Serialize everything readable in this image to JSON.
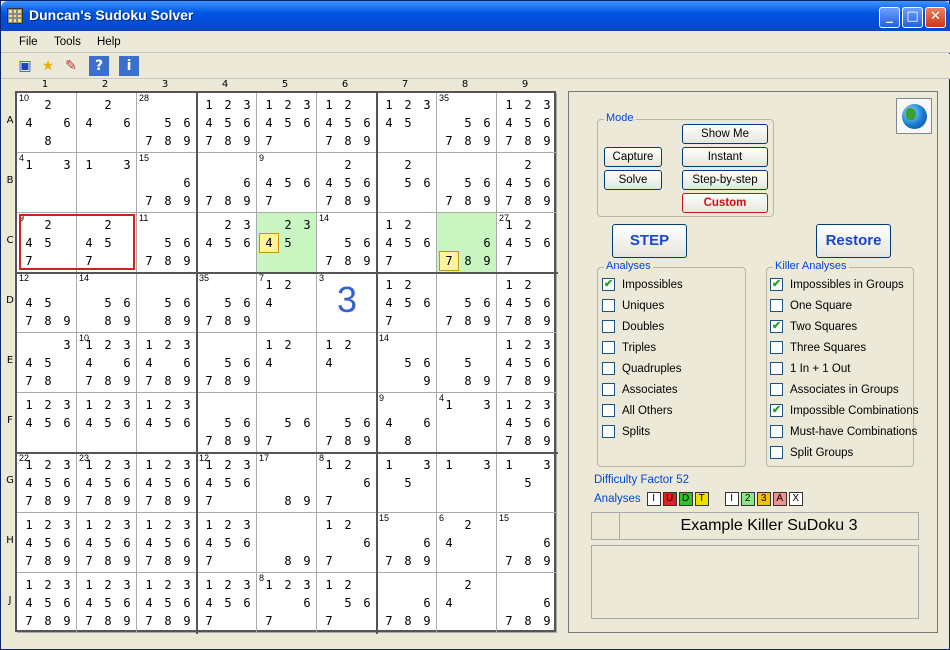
{
  "window": {
    "title": "Duncan's Sudoku Solver"
  },
  "menu": [
    "File",
    "Tools",
    "Help"
  ],
  "toolbar": {
    "icons": [
      "save-icon",
      "favorite-icon",
      "new-icon",
      "help-icon",
      "info-icon"
    ],
    "help": "?",
    "info": "i"
  },
  "columns": [
    "1",
    "2",
    "3",
    "4",
    "5",
    "6",
    "7",
    "8",
    "9"
  ],
  "rows": [
    "A",
    "B",
    "C",
    "D",
    "E",
    "F",
    "G",
    "H",
    "J"
  ],
  "cells": [
    [
      {
        "cage": "10",
        "c": [
          2,
          4,
          6,
          8
        ]
      },
      {
        "c": [
          2,
          4,
          6
        ]
      },
      {
        "cage": "28",
        "c": [
          5,
          6,
          7,
          8,
          9
        ]
      },
      {
        "c": [
          1,
          2,
          3,
          4,
          5,
          6,
          7,
          8,
          9
        ]
      },
      {
        "c": [
          1,
          2,
          3,
          4,
          5,
          6,
          7
        ]
      },
      {
        "c": [
          1,
          2,
          4,
          5,
          6,
          7,
          8,
          9
        ]
      },
      {
        "c": [
          1,
          2,
          3,
          4,
          5
        ]
      },
      {
        "cage": "35",
        "c": [
          5,
          6,
          7,
          8,
          9
        ]
      },
      {
        "c": [
          1,
          2,
          3,
          4,
          5,
          6,
          7,
          8,
          9
        ]
      }
    ],
    [
      {
        "cage": "4",
        "c": [
          1,
          3
        ]
      },
      {
        "c": [
          1,
          3
        ]
      },
      {
        "cage": "15",
        "c": [
          6,
          7,
          8,
          9
        ]
      },
      {
        "c": [
          6,
          7,
          8,
          9
        ]
      },
      {
        "cage": "9",
        "c": [
          4,
          5,
          6,
          7
        ]
      },
      {
        "c": [
          2,
          4,
          5,
          6,
          7,
          8,
          9
        ]
      },
      {
        "c": [
          2,
          5,
          6
        ]
      },
      {
        "c": [
          5,
          6,
          7,
          8,
          9
        ]
      },
      {
        "c": [
          2,
          4,
          5,
          6,
          7,
          8,
          9
        ]
      }
    ],
    [
      {
        "cage": "9",
        "c": [
          2,
          4,
          5,
          7
        ]
      },
      {
        "c": [
          2,
          4,
          5,
          7
        ]
      },
      {
        "cage": "11",
        "c": [
          5,
          6,
          7,
          8,
          9
        ]
      },
      {
        "c": [
          2,
          3,
          4,
          5,
          6
        ]
      },
      {
        "c": [
          2,
          3,
          4,
          5
        ],
        "hl": [
          4
        ],
        "green": true
      },
      {
        "cage": "14",
        "c": [
          5,
          6,
          7,
          8,
          9
        ]
      },
      {
        "c": [
          1,
          2,
          4,
          5,
          6,
          7
        ]
      },
      {
        "c": [
          6,
          7,
          8,
          9
        ],
        "hl": [
          7
        ],
        "green": true
      },
      {
        "cage": "27",
        "c": [
          1,
          2,
          4,
          5,
          6,
          7
        ]
      }
    ],
    [
      {
        "cage": "12",
        "c": [
          4,
          5,
          7,
          8,
          9
        ]
      },
      {
        "cage": "14",
        "c": [
          5,
          6,
          8,
          9
        ]
      },
      {
        "c": [
          5,
          6,
          8,
          9
        ]
      },
      {
        "cage": "35",
        "c": [
          5,
          6,
          7,
          8,
          9
        ]
      },
      {
        "cage": "7",
        "c": [
          1,
          2,
          4
        ]
      },
      {
        "cage": "3",
        "big": "3"
      },
      {
        "c": [
          1,
          2,
          4,
          5,
          6,
          7
        ]
      },
      {
        "c": [
          5,
          6,
          7,
          8,
          9
        ]
      },
      {
        "c": [
          1,
          2,
          4,
          5,
          6,
          7,
          8,
          9
        ]
      }
    ],
    [
      {
        "c": [
          3,
          4,
          5,
          7,
          8
        ]
      },
      {
        "cage": "10",
        "c": [
          1,
          2,
          3,
          4,
          6,
          7,
          8,
          9
        ]
      },
      {
        "c": [
          1,
          2,
          3,
          4,
          6,
          7,
          8,
          9
        ]
      },
      {
        "c": [
          5,
          6,
          7,
          8,
          9
        ]
      },
      {
        "c": [
          1,
          2,
          4
        ]
      },
      {
        "c": [
          1,
          2,
          4
        ]
      },
      {
        "cage": "14",
        "c": [
          5,
          6,
          9
        ]
      },
      {
        "c": [
          5,
          8,
          9
        ]
      },
      {
        "c": [
          1,
          2,
          3,
          4,
          5,
          6,
          7,
          8,
          9
        ]
      }
    ],
    [
      {
        "c": [
          1,
          2,
          3,
          4,
          5,
          6
        ]
      },
      {
        "c": [
          1,
          2,
          3,
          4,
          5,
          6
        ]
      },
      {
        "c": [
          1,
          2,
          3,
          4,
          5,
          6
        ]
      },
      {
        "c": [
          5,
          6,
          7,
          8,
          9
        ]
      },
      {
        "c": [
          5,
          6,
          7
        ]
      },
      {
        "c": [
          5,
          6,
          7,
          8,
          9
        ]
      },
      {
        "cage": "9",
        "c": [
          4,
          6,
          8
        ]
      },
      {
        "cage": "4",
        "c": [
          1,
          3
        ]
      },
      {
        "c": [
          1,
          2,
          3,
          4,
          5,
          6,
          7,
          8,
          9
        ]
      }
    ],
    [
      {
        "cage": "22",
        "c": [
          1,
          2,
          3,
          4,
          5,
          6,
          7,
          8,
          9
        ]
      },
      {
        "cage": "23",
        "c": [
          1,
          2,
          3,
          4,
          5,
          6,
          7,
          8,
          9
        ]
      },
      {
        "c": [
          1,
          2,
          3,
          4,
          5,
          6,
          7,
          8,
          9
        ]
      },
      {
        "cage": "12",
        "c": [
          1,
          2,
          3,
          4,
          5,
          6,
          7
        ]
      },
      {
        "cage": "17",
        "c": [
          8,
          9
        ]
      },
      {
        "cage": "8",
        "c": [
          1,
          2,
          6,
          7
        ]
      },
      {
        "c": [
          1,
          3,
          5
        ]
      },
      {
        "c": [
          1,
          3
        ]
      },
      {
        "c": [
          1,
          3,
          5
        ]
      }
    ],
    [
      {
        "c": [
          1,
          2,
          3,
          4,
          5,
          6,
          7,
          8,
          9
        ]
      },
      {
        "c": [
          1,
          2,
          3,
          4,
          5,
          6,
          7,
          8,
          9
        ]
      },
      {
        "c": [
          1,
          2,
          3,
          4,
          5,
          6,
          7,
          8,
          9
        ]
      },
      {
        "c": [
          1,
          2,
          3,
          4,
          5,
          6,
          7
        ]
      },
      {
        "c": [
          8,
          9
        ]
      },
      {
        "c": [
          1,
          2,
          6,
          7
        ]
      },
      {
        "cage": "15",
        "c": [
          6,
          7,
          8,
          9
        ]
      },
      {
        "cage": "6",
        "c": [
          2,
          4
        ]
      },
      {
        "cage": "15",
        "c": [
          6,
          7,
          8,
          9
        ]
      }
    ],
    [
      {
        "c": [
          1,
          2,
          3,
          4,
          5,
          6,
          7,
          8,
          9
        ]
      },
      {
        "c": [
          1,
          2,
          3,
          4,
          5,
          6,
          7,
          8,
          9
        ]
      },
      {
        "c": [
          1,
          2,
          3,
          4,
          5,
          6,
          7,
          8,
          9
        ]
      },
      {
        "c": [
          1,
          2,
          3,
          4,
          5,
          6,
          7
        ]
      },
      {
        "cage": "8",
        "c": [
          1,
          2,
          3,
          6,
          7
        ]
      },
      {
        "c": [
          1,
          2,
          5,
          6,
          7
        ]
      },
      {
        "c": [
          6,
          7,
          8,
          9
        ]
      },
      {
        "c": [
          2,
          4
        ]
      },
      {
        "c": [
          6,
          7,
          8,
          9
        ]
      }
    ]
  ],
  "panel": {
    "mode_label": "Mode",
    "capture": "Capture",
    "solve": "Solve",
    "show_me": "Show Me",
    "instant": "Instant",
    "step_by_step": "Step-by-step",
    "custom": "Custom",
    "step": "STEP",
    "restore": "Restore",
    "analyses_label": "Analyses",
    "analyses": [
      {
        "l": "Impossibles",
        "c": true
      },
      {
        "l": "Uniques",
        "c": false
      },
      {
        "l": "Doubles",
        "c": false
      },
      {
        "l": "Triples",
        "c": false
      },
      {
        "l": "Quadruples",
        "c": false
      },
      {
        "l": "Associates",
        "c": false
      },
      {
        "l": "All Others",
        "c": false
      },
      {
        "l": "Splits",
        "c": false
      }
    ],
    "killer_label": "Killer Analyses",
    "killer": [
      {
        "l": "Impossibles in Groups",
        "c": true
      },
      {
        "l": "One Square",
        "c": false
      },
      {
        "l": "Two Squares",
        "c": true
      },
      {
        "l": "Three Squares",
        "c": false
      },
      {
        "l": "1 In + 1 Out",
        "c": false
      },
      {
        "l": "Associates in Groups",
        "c": false
      },
      {
        "l": "Impossible Combinations",
        "c": true
      },
      {
        "l": "Must-have Combinations",
        "c": false
      },
      {
        "l": "Split Groups",
        "c": false
      }
    ],
    "difficulty": "Difficulty Factor 52",
    "analyses_text": "Analyses",
    "badges1": [
      {
        "t": "I",
        "c": "#ffffff"
      },
      {
        "t": "U",
        "c": "#e02020"
      },
      {
        "t": "D",
        "c": "#30c030"
      },
      {
        "t": "T",
        "c": "#f0e000"
      }
    ],
    "badges2": [
      {
        "t": "I",
        "c": "#ffffff"
      },
      {
        "t": "2",
        "c": "#88e888"
      },
      {
        "t": "3",
        "c": "#f0c000"
      },
      {
        "t": "A",
        "c": "#f09090"
      },
      {
        "t": "X",
        "c": "#ffffff"
      }
    ],
    "puzzle_name": "Example Killer SuDoku 3"
  }
}
